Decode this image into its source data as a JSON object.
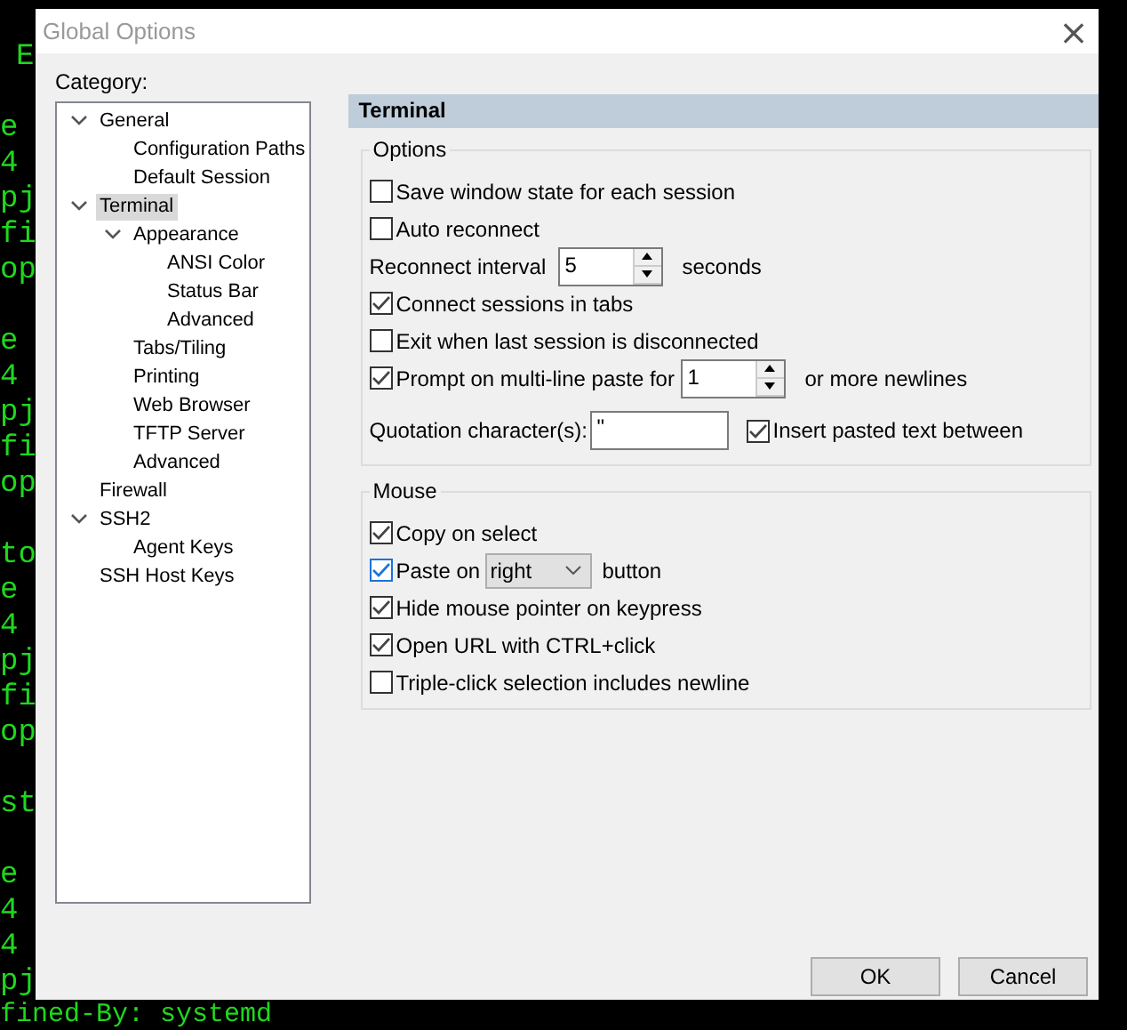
{
  "terminal": {
    "blocks": [
      [
        "E"
      ],
      [
        "e",
        "4",
        "pj",
        "fi",
        "op"
      ],
      [
        "e",
        "4",
        "pj",
        "fi",
        "op"
      ],
      [
        "to",
        "e",
        "4",
        "pj",
        "fi",
        "op"
      ],
      [
        "st"
      ],
      [
        "e",
        "4",
        "4",
        "pj"
      ]
    ],
    "bottom_line": "fined-By: systemd"
  },
  "window": {
    "title": "Global Options",
    "close": "×"
  },
  "category": {
    "label": "Category:",
    "tree": [
      {
        "label": "General",
        "expanded": true,
        "selected": false,
        "children": [
          {
            "label": "Configuration Paths",
            "selected": false
          },
          {
            "label": "Default Session",
            "selected": false
          }
        ]
      },
      {
        "label": "Terminal",
        "expanded": true,
        "selected": true,
        "children": [
          {
            "label": "Appearance",
            "expanded": true,
            "selected": false,
            "children": [
              {
                "label": "ANSI Color",
                "selected": false
              },
              {
                "label": "Status Bar",
                "selected": false
              },
              {
                "label": "Advanced",
                "selected": false
              }
            ]
          },
          {
            "label": "Tabs/Tiling",
            "selected": false
          },
          {
            "label": "Printing",
            "selected": false
          },
          {
            "label": "Web Browser",
            "selected": false
          },
          {
            "label": "TFTP Server",
            "selected": false
          },
          {
            "label": "Advanced",
            "selected": false
          }
        ]
      },
      {
        "label": "Firewall",
        "selected": false
      },
      {
        "label": "SSH2",
        "expanded": true,
        "selected": false,
        "children": [
          {
            "label": "Agent Keys",
            "selected": false
          }
        ]
      },
      {
        "label": "SSH Host Keys",
        "selected": false
      }
    ]
  },
  "panel": {
    "header": "Terminal",
    "groups": [
      {
        "title": "Options",
        "rows": [
          {
            "kind": "checkbox",
            "label": "Save window state for each session",
            "checked": false
          },
          {
            "kind": "checkbox",
            "label": "Auto reconnect",
            "checked": false
          },
          {
            "kind": "spinner",
            "label": "Reconnect interval",
            "value": "5",
            "suffix": "seconds"
          },
          {
            "kind": "checkbox",
            "label": "Connect sessions in tabs",
            "checked": true
          },
          {
            "kind": "checkbox",
            "label": "Exit when last session is disconnected",
            "checked": false
          },
          {
            "kind": "checkbox_spinner",
            "label": "Prompt on multi-line paste for",
            "checked": true,
            "value": "1",
            "suffix": "or more newlines"
          },
          {
            "kind": "quote",
            "label": "Quotation character(s):",
            "value": "\"",
            "check_label": "Insert pasted text between",
            "checked": true
          }
        ]
      },
      {
        "title": "Mouse",
        "rows": [
          {
            "kind": "checkbox",
            "label": "Copy on select",
            "checked": true
          },
          {
            "kind": "checkbox_select",
            "label": "Paste on",
            "checked": true,
            "focused": true,
            "value": "right",
            "suffix": "button"
          },
          {
            "kind": "checkbox",
            "label": "Hide mouse pointer on keypress",
            "checked": true
          },
          {
            "kind": "checkbox",
            "label": "Open URL with CTRL+click",
            "checked": true
          },
          {
            "kind": "checkbox",
            "label": "Triple-click selection includes newline",
            "checked": false
          }
        ]
      }
    ]
  },
  "buttons": [
    "OK",
    "Cancel"
  ]
}
